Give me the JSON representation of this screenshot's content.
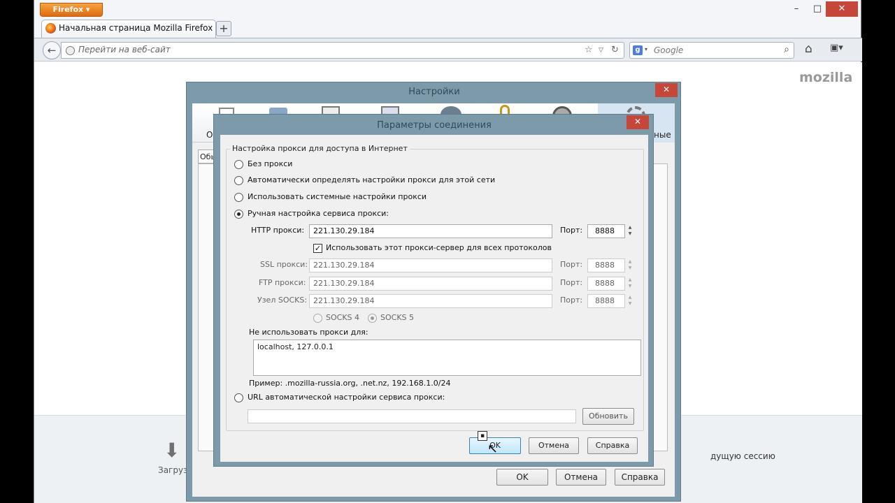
{
  "browser": {
    "menu_button": "Firefox",
    "tab_title": "Начальная страница Mozilla Firefox",
    "new_tab": "+",
    "url_placeholder": "Перейти на веб-сайт",
    "search_placeholder": "Google",
    "brand": "mozilla",
    "downloads_label": "Загрузк",
    "restore_session": "дущую сессию",
    "window_controls": [
      "–",
      "□",
      "✕"
    ]
  },
  "settings_dialog": {
    "title": "Настройки",
    "left_label": "Ос",
    "right_label": "ные",
    "subtab": "Обы",
    "ok": "OK",
    "cancel": "Отмена",
    "help": "Справка"
  },
  "connection_dialog": {
    "title": "Параметры соединения",
    "group_title": "Настройка прокси для доступа в Интернет",
    "options": {
      "no_proxy": "Без прокси",
      "auto_detect": "Автоматически определять настройки прокси для этой сети",
      "system": "Использовать системные настройки прокси",
      "manual": "Ручная настройка сервиса прокси:",
      "auto_url": "URL автоматической настройки сервиса прокси:"
    },
    "selected_option": "manual",
    "port_label": "Порт:",
    "http": {
      "label": "HTTP прокси:",
      "value": "221.130.29.184",
      "port": "8888"
    },
    "use_for_all": {
      "label": "Использовать этот прокси-сервер для всех протоколов",
      "checked": true
    },
    "ssl": {
      "label": "SSL прокси:",
      "value": "221.130.29.184",
      "port": "8888"
    },
    "ftp": {
      "label": "FTP прокси:",
      "value": "221.130.29.184",
      "port": "8888"
    },
    "socks": {
      "label": "Узел SOCKS:",
      "value": "221.130.29.184",
      "port": "8888"
    },
    "socks4": "SOCKS 4",
    "socks5": "SOCKS 5",
    "no_proxy_for_label": "Не использовать прокси для:",
    "no_proxy_for_value": "localhost, 127.0.0.1",
    "example": "Пример: .mozilla-russia.org, .net.nz, 192.168.1.0/24",
    "auto_url_value": "",
    "reload": "Обновить",
    "ok": "OK",
    "cancel": "Отмена",
    "help": "Справка"
  },
  "colors": {
    "dialog_frame": "#7c9aa9",
    "close_button": "#c7463a",
    "firefox_orange": "#e06a10"
  }
}
